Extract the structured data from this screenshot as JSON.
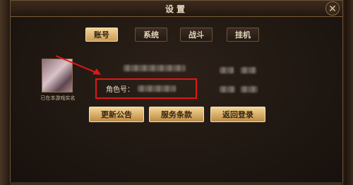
{
  "dialog": {
    "title": "设置",
    "close_glyph": "✕"
  },
  "tabs": [
    {
      "label": "账号",
      "active": true
    },
    {
      "label": "系统",
      "active": false
    },
    {
      "label": "战斗",
      "active": false
    },
    {
      "label": "挂机",
      "active": false
    }
  ],
  "account": {
    "realname_note": "已在本游戏实名",
    "role_id_label": "角色号："
  },
  "buttons": {
    "announcement": "更新公告",
    "terms": "服务条款",
    "return_login": "返回登录"
  },
  "colors": {
    "highlight_box": "#e01717",
    "annotation_arrow": "#e01717"
  }
}
